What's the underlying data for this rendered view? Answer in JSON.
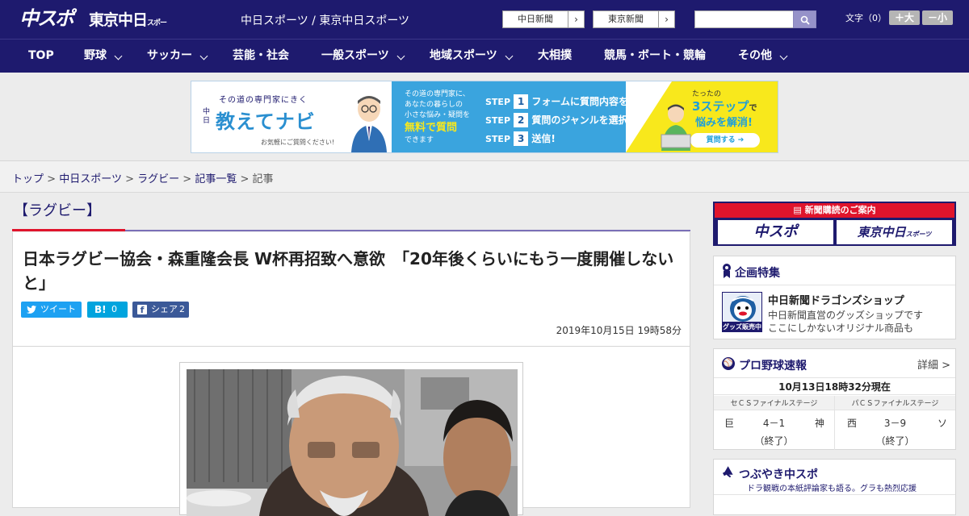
{
  "header": {
    "logo_chuspo": "中スポ",
    "logo_tokyo": "東京中日",
    "logo_tokyo_small": "スポーツ",
    "site_title": "中日スポーツ / 東京中日スポーツ",
    "paper_links": [
      "中日新聞",
      "東京新聞"
    ],
    "search": {
      "placeholder": "",
      "button_icon": "search-icon"
    },
    "font_size": {
      "label": "文字（0）",
      "increase": "＋大",
      "decrease": "－小"
    }
  },
  "nav": {
    "items": [
      {
        "label": "TOP",
        "has_menu": false
      },
      {
        "label": "野球",
        "has_menu": true
      },
      {
        "label": "サッカー",
        "has_menu": true
      },
      {
        "label": "芸能・社会",
        "has_menu": false
      },
      {
        "label": "一般スポーツ",
        "has_menu": true
      },
      {
        "label": "地域スポーツ",
        "has_menu": true
      },
      {
        "label": "大相撲",
        "has_menu": false
      },
      {
        "label": "競馬・ボート・競輪",
        "has_menu": false
      },
      {
        "label": "その他",
        "has_menu": true
      }
    ]
  },
  "ad_banner": {
    "tagline": "その道の専門家にきく",
    "brand_small": "中日",
    "brand": "教えてナビ",
    "note": "お気軽にご質問ください!",
    "mid_text": [
      "その道の専門家に、",
      "あなたの暮らしの",
      "小さな悩み・疑問を",
      "無料で質問",
      "できます"
    ],
    "steps": [
      {
        "step": "STEP",
        "num": "1",
        "text": "フォームに質問内容を入力"
      },
      {
        "step": "STEP",
        "num": "2",
        "text": "質問のジャンルを選択"
      },
      {
        "step": "STEP",
        "num": "3",
        "text": "送信!"
      }
    ],
    "right_top": "たったの",
    "right_big": "3ステップ",
    "right_suffix": "で",
    "right_sub": "悩みを解消!",
    "right_cta": "質問する",
    "colors": {
      "mid": "#3aa4de",
      "right": "#f8e81c"
    }
  },
  "breadcrumb": {
    "items": [
      "トップ",
      "中日スポーツ",
      "ラグビー",
      "記事一覧"
    ],
    "current": "記事",
    "sep": ">"
  },
  "article": {
    "category": "【ラグビー】",
    "headline": "日本ラグビー協会・森重隆会長 W杯再招致へ意欲　「20年後くらいにもう一度開催しないと」",
    "share": {
      "tweet_label": "ツイート",
      "hatena_label": "B!",
      "hatena_count": "0",
      "facebook_label": "シェア",
      "facebook_count": "2"
    },
    "date": "2019年10月15日 19時58分"
  },
  "sidebar": {
    "subscription": {
      "title": "新聞購読のご案内",
      "buttons": [
        "中スポ",
        "東京中日"
      ],
      "button_small": "スポーツ"
    },
    "feature": {
      "title": "企画特集",
      "item_title": "中日新聞ドラゴンズショップ",
      "item_desc_1": "中日新聞直営のグッズショップです",
      "item_desc_2": "ここにしかないオリジナル商品も",
      "thumb_label": "グッズ販売中"
    },
    "baseball": {
      "title": "プロ野球速報",
      "more": "詳細 >",
      "as_of": "10月13日18時32分現在",
      "games": [
        {
          "stage": "セＣＳファイナルステージ",
          "home": "巨",
          "score": "4－1",
          "away": "神",
          "status": "（終了）"
        },
        {
          "stage": "パＣＳファイナルステージ",
          "home": "西",
          "score": "3－9",
          "away": "ソ",
          "status": "（終了）"
        }
      ]
    },
    "tsubuyaki": {
      "title": "つぶやき中スポ",
      "subtitle": "ドラ観戦の本紙評論家も語る。グラも熱烈応援"
    }
  },
  "colors": {
    "brand": "#1e1a6e",
    "accent_red": "#e0142c",
    "twitter": "#1da1f2",
    "hatena": "#00a4de",
    "facebook": "#3b5998"
  }
}
